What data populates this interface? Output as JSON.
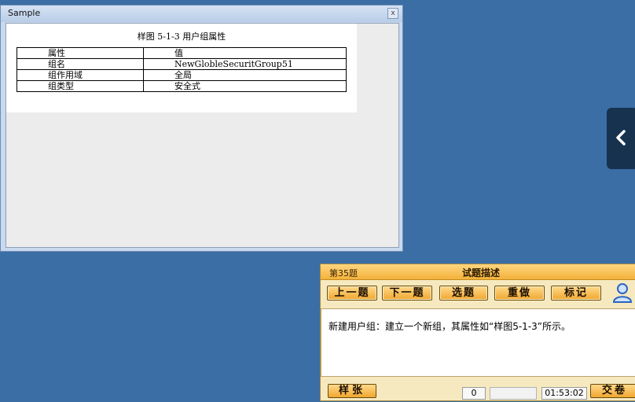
{
  "sample_window": {
    "title": "Sample",
    "close_glyph": "x",
    "figure_caption": "样图 5-1-3   用户组属性",
    "table": {
      "headers": [
        "属性",
        "值"
      ],
      "rows": [
        [
          "组名",
          "NewGlobleSecuritGroup51"
        ],
        [
          "组作用域",
          "全局"
        ],
        [
          "组类型",
          "安全式"
        ]
      ]
    }
  },
  "side_tab": {
    "icon": "chevron-left-icon"
  },
  "exam_panel": {
    "question_number": "第35题",
    "title": "试题描述",
    "buttons": {
      "prev": "上一题",
      "next": "下一题",
      "select": "选题",
      "redo": "重做",
      "mark": "标记"
    },
    "user_icon": "user-icon",
    "question_text": "新建用户组：建立一个新组，其属性如“样图5-1-3”所示。",
    "footer": {
      "sample_label": "样张",
      "count": "0",
      "timer": "01:53:02",
      "submit_label": "交卷"
    }
  },
  "colors": {
    "desktop": "#3b6ea5",
    "accent": "#f0a72f",
    "side_tab": "#16324f"
  }
}
